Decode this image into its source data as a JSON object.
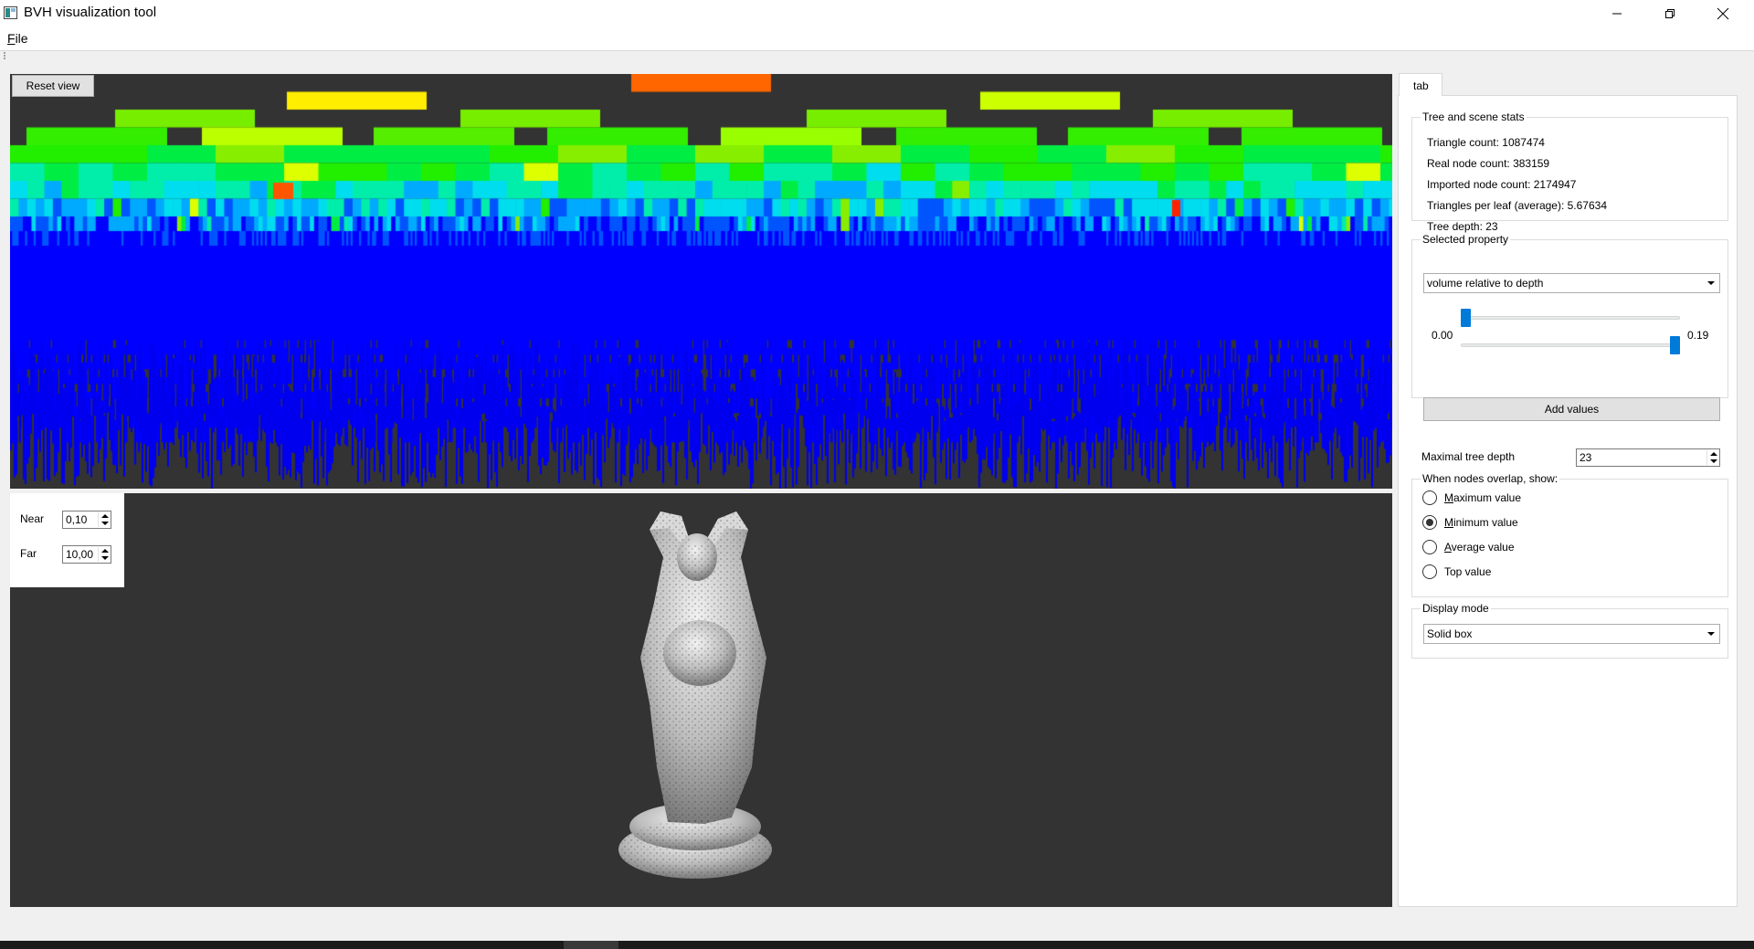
{
  "window": {
    "title": "BVH visualization tool",
    "controls": [
      "minimize",
      "maximize",
      "close"
    ]
  },
  "menu": {
    "file_label_underlined": "F",
    "file_label_rest": "ile"
  },
  "heatmap": {
    "reset_label": "Reset view",
    "tree_depth_levels": 23,
    "colors": {
      "background": "#333333",
      "top_node": "#ff6600",
      "level_1": "#ffee00",
      "level_2": "#88ee00",
      "level_3": "#22ee00",
      "deep_nodes": "#0000ff"
    }
  },
  "render": {
    "near_label": "Near",
    "near_value": "0,10",
    "far_label": "Far",
    "far_value": "10,00",
    "model": "buddha-statue"
  },
  "side": {
    "tab_label": "tab",
    "stats": {
      "title": "Tree and scene stats",
      "triangle_count": "Triangle count: 1087474",
      "real_node_count": "Real node count: 383159",
      "imported_node_count": "Imported node count: 2174947",
      "triangles_per_leaf": "Triangles per leaf (average): 5.67634",
      "tree_depth": "Tree depth: 23"
    },
    "property": {
      "title": "Selected property",
      "selected": "volume relative to depth",
      "range_min": 0.0,
      "range_max": 0.19,
      "lower_handle_fraction": 0.0,
      "upper_handle_fraction": 1.0,
      "min_label": "0.00",
      "max_label": "0.19",
      "add_values_label": "Add values"
    },
    "max_depth": {
      "label": "Maximal tree depth",
      "value": "23"
    },
    "overlap": {
      "title": "When nodes overlap, show:",
      "options": [
        {
          "u": "M",
          "rest": "aximum value",
          "checked": false
        },
        {
          "u": "M",
          "rest": "inimum value",
          "checked": true
        },
        {
          "u": "A",
          "rest": "verage value",
          "checked": false
        },
        {
          "u": "T",
          "rest": "op value",
          "checked": false,
          "u_index": 1
        }
      ]
    },
    "display": {
      "title": "Display mode",
      "selected": "Solid box"
    }
  }
}
